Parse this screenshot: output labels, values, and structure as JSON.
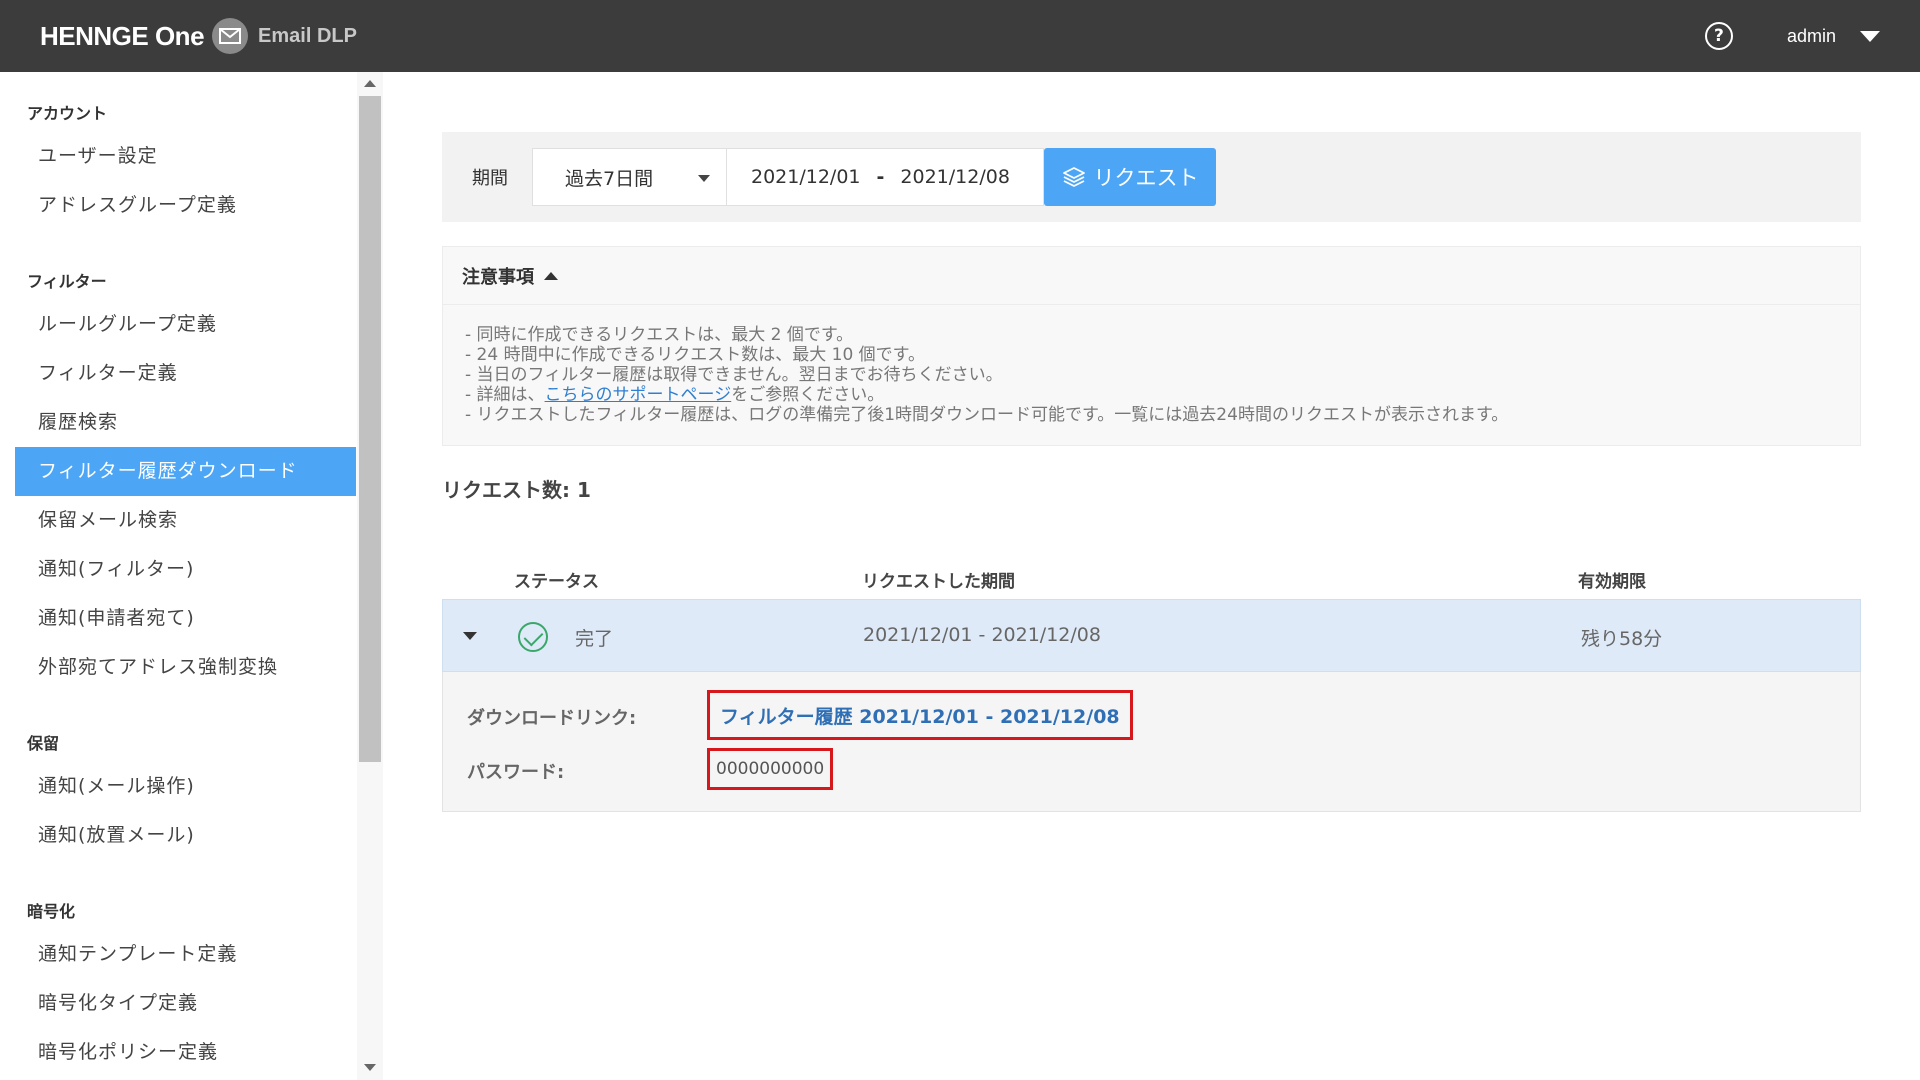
{
  "header": {
    "brand": "HENNGE One",
    "product": "Email DLP",
    "help_glyph": "?",
    "user": "admin"
  },
  "sidebar": {
    "sections": [
      {
        "title": "アカウント",
        "items": [
          "ユーザー設定",
          "アドレスグループ定義"
        ]
      },
      {
        "title": "フィルター",
        "items": [
          "ルールグループ定義",
          "フィルター定義",
          "履歴検索",
          "フィルター履歴ダウンロード",
          "保留メール検索",
          "通知(フィルター)",
          "通知(申請者宛て)",
          "外部宛てアドレス強制変換"
        ]
      },
      {
        "title": "保留",
        "items": [
          "通知(メール操作)",
          "通知(放置メール)"
        ]
      },
      {
        "title": "暗号化",
        "items": [
          "通知テンプレート定義",
          "暗号化タイプ定義",
          "暗号化ポリシー定義"
        ]
      }
    ],
    "active_item": "フィルター履歴ダウンロード"
  },
  "filter": {
    "period_label": "期間",
    "period_value": "過去7日間",
    "date_from": "2021/12/01",
    "date_separator": "-",
    "date_to": "2021/12/08",
    "request_button": "リクエスト"
  },
  "notice": {
    "title": "注意事項",
    "lines": [
      "- 同時に作成できるリクエストは、最大 2 個です。",
      "- 24 時間中に作成できるリクエスト数は、最大 10 個です。",
      "- 当日のフィルター履歴は取得できません。翌日までお待ちください。"
    ],
    "line4_prefix": "- 詳細は、",
    "line4_link": "こちらのサポートページ",
    "line4_suffix": "をご参照ください。",
    "line5": "- リクエストしたフィルター履歴は、ログの準備完了後1時間ダウンロード可能です。一覧には過去24時間のリクエストが表示されます。"
  },
  "requests": {
    "count_label": "リクエスト数: 1",
    "columns": {
      "status": "ステータス",
      "period": "リクエストした期間",
      "expiry": "有効期限"
    },
    "row": {
      "status": "完了",
      "period": "2021/12/01 - 2021/12/08",
      "expiry": "残り58分"
    },
    "detail": {
      "download_label": "ダウンロードリンク:",
      "download_link": "フィルター履歴 2021/12/01 - 2021/12/08",
      "password_label": "パスワード:",
      "password_value": "0000000000"
    }
  },
  "colors": {
    "header_bg": "#3c3c3c",
    "accent": "#4da6f5",
    "highlight_border": "#d6171c",
    "status_ok": "#3aa86a"
  }
}
